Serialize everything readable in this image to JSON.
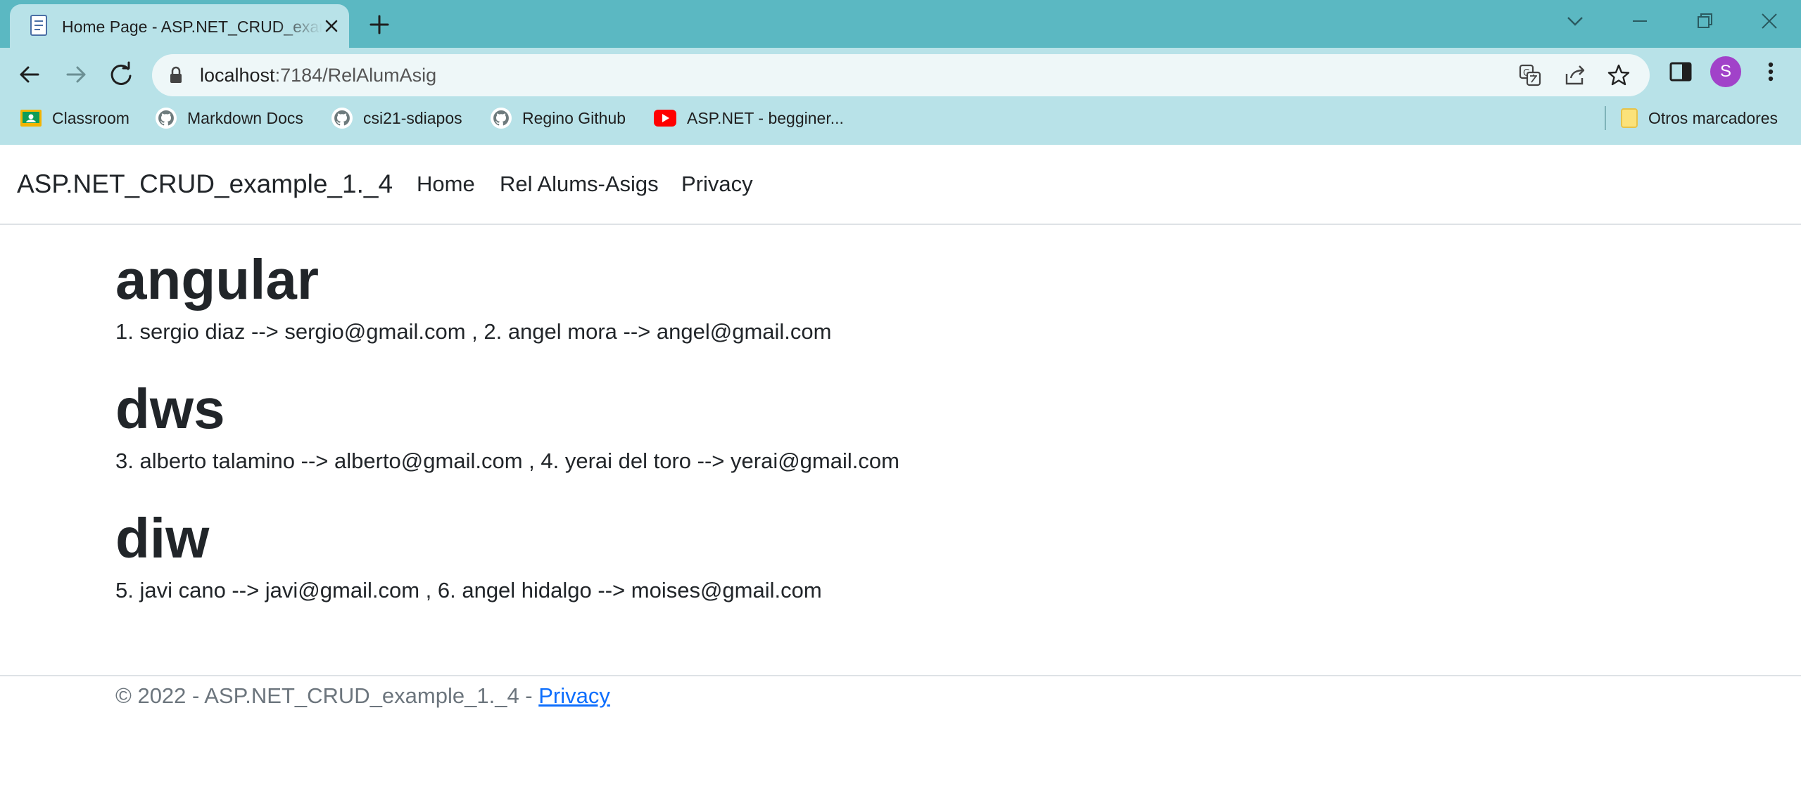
{
  "browser": {
    "tab": {
      "title": "Home Page - ASP.NET_CRUD_example_1._4"
    },
    "address": {
      "host": "localhost",
      "path": ":7184/RelAlumAsig"
    },
    "avatar_letter": "S",
    "bookmarks": [
      {
        "label": "Classroom",
        "icon": "classroom-icon"
      },
      {
        "label": "Markdown Docs",
        "icon": "github-icon"
      },
      {
        "label": "csi21-sdiapos",
        "icon": "github-icon"
      },
      {
        "label": "Regino Github",
        "icon": "github-icon"
      },
      {
        "label": "ASP.NET - begginer...",
        "icon": "youtube-icon"
      }
    ],
    "other_bookmarks": "Otros marcadores",
    "colors": {
      "tabstrip": "#5bb8c2",
      "toolbar": "#b8e2e8",
      "avatar": "#a142c9"
    }
  },
  "site": {
    "brand": "ASP.NET_CRUD_example_1._4",
    "nav": [
      "Home",
      "Rel Alums-Asigs",
      "Privacy"
    ]
  },
  "subjects": [
    {
      "name": "angular",
      "students": "1. sergio diaz --> sergio@gmail.com , 2. angel mora --> angel@gmail.com"
    },
    {
      "name": "dws",
      "students": "3. alberto talamino --> alberto@gmail.com , 4. yerai del toro --> yerai@gmail.com"
    },
    {
      "name": "diw",
      "students": "5. javi cano --> javi@gmail.com , 6. angel hidalgo --> moises@gmail.com"
    }
  ],
  "footer": {
    "text": "© 2022 - ASP.NET_CRUD_example_1._4 - ",
    "link": "Privacy"
  }
}
